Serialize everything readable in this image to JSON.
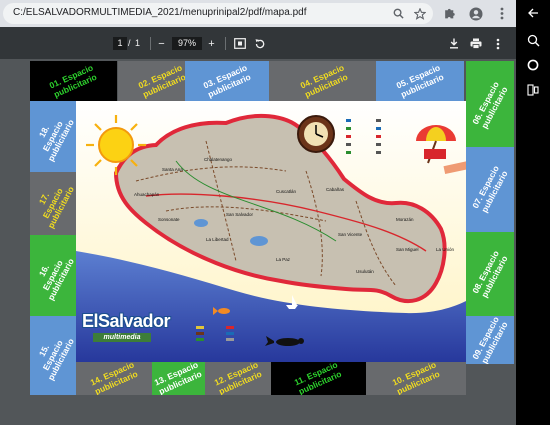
{
  "browser": {
    "url": "C:/ELSALVADORMULTIMEDIA_2021/menuprinipal2/pdf/mapa.pdf"
  },
  "pdf_toolbar": {
    "page_current": "1",
    "page_separator": "/",
    "page_total": "1",
    "zoom": "97%",
    "zoom_out": "−",
    "zoom_in": "+"
  },
  "board": {
    "tiles": [
      {
        "label": "01. Espacio\npublicitario",
        "bg": "#000000",
        "fg": "#2dd32d"
      },
      {
        "label": "02. Espacio\npublicitario",
        "bg": "#686a6d",
        "fg": "#f2dd1f"
      },
      {
        "label": "03. Espacio\npublicitario",
        "bg": "#5f95d4",
        "fg": "#ffffff"
      },
      {
        "label": "04. Espacio\npublicitario",
        "bg": "#686a6d",
        "fg": "#f2dd1f"
      },
      {
        "label": "05. Espacio\npublicitario",
        "bg": "#5f95d4",
        "fg": "#ffffff"
      },
      {
        "label": "06. Espacio\npublicitario",
        "bg": "#3cb53c",
        "fg": "#ffffff"
      },
      {
        "label": "07. Espacio\npublicitario",
        "bg": "#5f95d4",
        "fg": "#ffffff"
      },
      {
        "label": "08. Espacio\npublicitario",
        "bg": "#3cb53c",
        "fg": "#ffffff"
      },
      {
        "label": "09. Espacio\npublicitario",
        "bg": "#5f95d4",
        "fg": "#ffffff"
      },
      {
        "label": "10. Espacio\npublicitario",
        "bg": "#686a6d",
        "fg": "#f2dd1f"
      },
      {
        "label": "11. Espacio\npublicitario",
        "bg": "#000000",
        "fg": "#2dd32d"
      },
      {
        "label": "12. Espacio\npublicitario",
        "bg": "#686a6d",
        "fg": "#f2dd1f"
      },
      {
        "label": "13. Espacio\npublicitario",
        "bg": "#3cb53c",
        "fg": "#ffffff"
      },
      {
        "label": "14. Espacio\npublicitario",
        "bg": "#686a6d",
        "fg": "#f2dd1f"
      },
      {
        "label": "15. Espacio\npublicitario",
        "bg": "#5f95d4",
        "fg": "#ffffff"
      },
      {
        "label": "16. Espacio\npublicitario",
        "bg": "#3cb53c",
        "fg": "#ffffff"
      },
      {
        "label": "17. Espacio\npublicitario",
        "bg": "#686a6d",
        "fg": "#f2dd1f"
      },
      {
        "label": "18. Espacio\npublicitario",
        "bg": "#5f95d4",
        "fg": "#ffffff"
      }
    ],
    "logo": {
      "main": "ElSalvador",
      "sub": "multimedia"
    },
    "map_labels": [
      "Chalatenango",
      "Santa Ana",
      "Ahuachapán",
      "Sonsonate",
      "La Libertad",
      "San Salvador",
      "Cuscatlán",
      "Cabañas",
      "San Vicente",
      "La Paz",
      "Usulután",
      "San Miguel",
      "Morazán",
      "La Unión"
    ]
  },
  "icons": {
    "search": "search-icon",
    "star": "bookmark-star-icon",
    "extensions": "puzzle-icon",
    "profile": "account-icon",
    "menu": "kebab-icon",
    "download": "download-icon",
    "print": "print-icon",
    "fit": "fit-page-icon",
    "rotate": "rotate-icon"
  }
}
